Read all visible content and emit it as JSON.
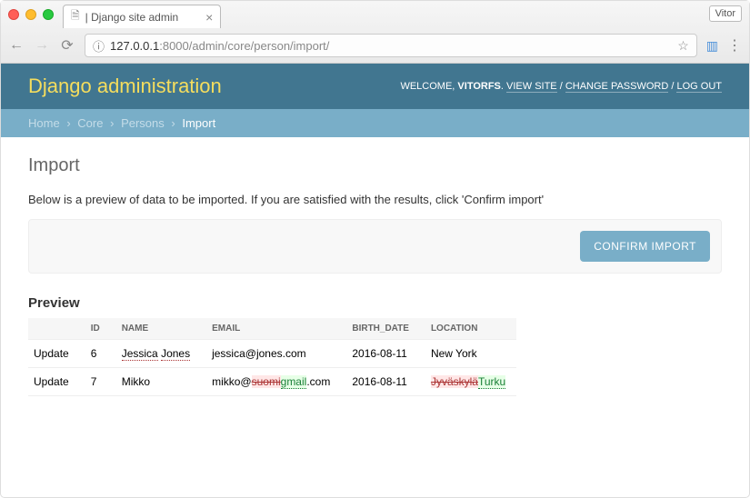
{
  "browser": {
    "tab_title": "| Django site admin",
    "profile": "Vitor",
    "url_host": "127.0.0.1",
    "url_path": ":8000/admin/core/person/import/"
  },
  "header": {
    "brand": "Django administration",
    "welcome": "WELCOME,",
    "user": "VITORFS",
    "view_site": "VIEW SITE",
    "change_password": "CHANGE PASSWORD",
    "logout": "LOG OUT"
  },
  "breadcrumbs": {
    "home": "Home",
    "core": "Core",
    "persons": "Persons",
    "current": "Import"
  },
  "page": {
    "title": "Import",
    "help": "Below is a preview of data to be imported. If you are satisfied with the results, click 'Confirm import'",
    "confirm_button": "Confirm import",
    "preview_heading": "Preview"
  },
  "preview": {
    "columns": {
      "c0": "",
      "c1": "ID",
      "c2": "NAME",
      "c3": "EMAIL",
      "c4": "BIRTH_DATE",
      "c5": "LOCATION"
    },
    "rows": [
      {
        "action": "Update",
        "id": "6",
        "name_old": "Jessica",
        "name_new": "Jones",
        "email_plain": "jessica@jones.com",
        "birth_date": "2016-08-11",
        "location_plain": "New York"
      },
      {
        "action": "Update",
        "id": "7",
        "name_plain": "Mikko",
        "email_prefix": "mikko@",
        "email_del": "suomi",
        "email_ins": "gmail",
        "email_suffix": ".com",
        "birth_date": "2016-08-11",
        "loc_del": "Jyväskylä",
        "loc_ins": "Turku"
      }
    ]
  }
}
